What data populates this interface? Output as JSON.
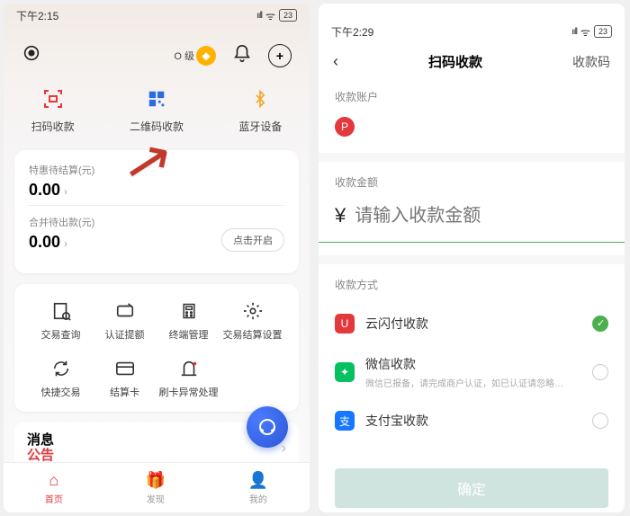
{
  "left": {
    "status": {
      "time": "下午2:15",
      "battery": "23"
    },
    "header": {
      "vip_prefix": "O 级"
    },
    "quick": [
      {
        "label": "扫码收款"
      },
      {
        "label": "二维码收款"
      },
      {
        "label": "蓝牙设备"
      }
    ],
    "balances": {
      "a_label": "特惠待结算(元)",
      "a_value": "0.00",
      "b_label": "合并待出款(元)",
      "b_value": "0.00",
      "toggle_label": "点击开启"
    },
    "grid": [
      "交易查询",
      "认证提额",
      "终端管理",
      "交易结算设置",
      "快捷交易",
      "结算卡",
      "刷卡异常处理"
    ],
    "announce": {
      "line1": "消息",
      "line2": "公告"
    },
    "nav": [
      {
        "label": "首页",
        "active": true
      },
      {
        "label": "发现",
        "active": false
      },
      {
        "label": "我的",
        "active": false
      }
    ]
  },
  "right": {
    "status": {
      "time": "下午2:29",
      "battery": "23"
    },
    "header": {
      "title": "扫码收款",
      "action": "收款码"
    },
    "account_label": "收款账户",
    "amount_label": "收款金额",
    "amount_placeholder": "请输入收款金额",
    "method_label": "收款方式",
    "methods": [
      {
        "label": "云闪付收款",
        "selected": true,
        "sub": ""
      },
      {
        "label": "微信收款",
        "selected": false,
        "sub": "微信已报备，请完成商户认证，如已认证请忽略…"
      },
      {
        "label": "支付宝收款",
        "selected": false,
        "sub": ""
      }
    ],
    "confirm": "确定"
  }
}
